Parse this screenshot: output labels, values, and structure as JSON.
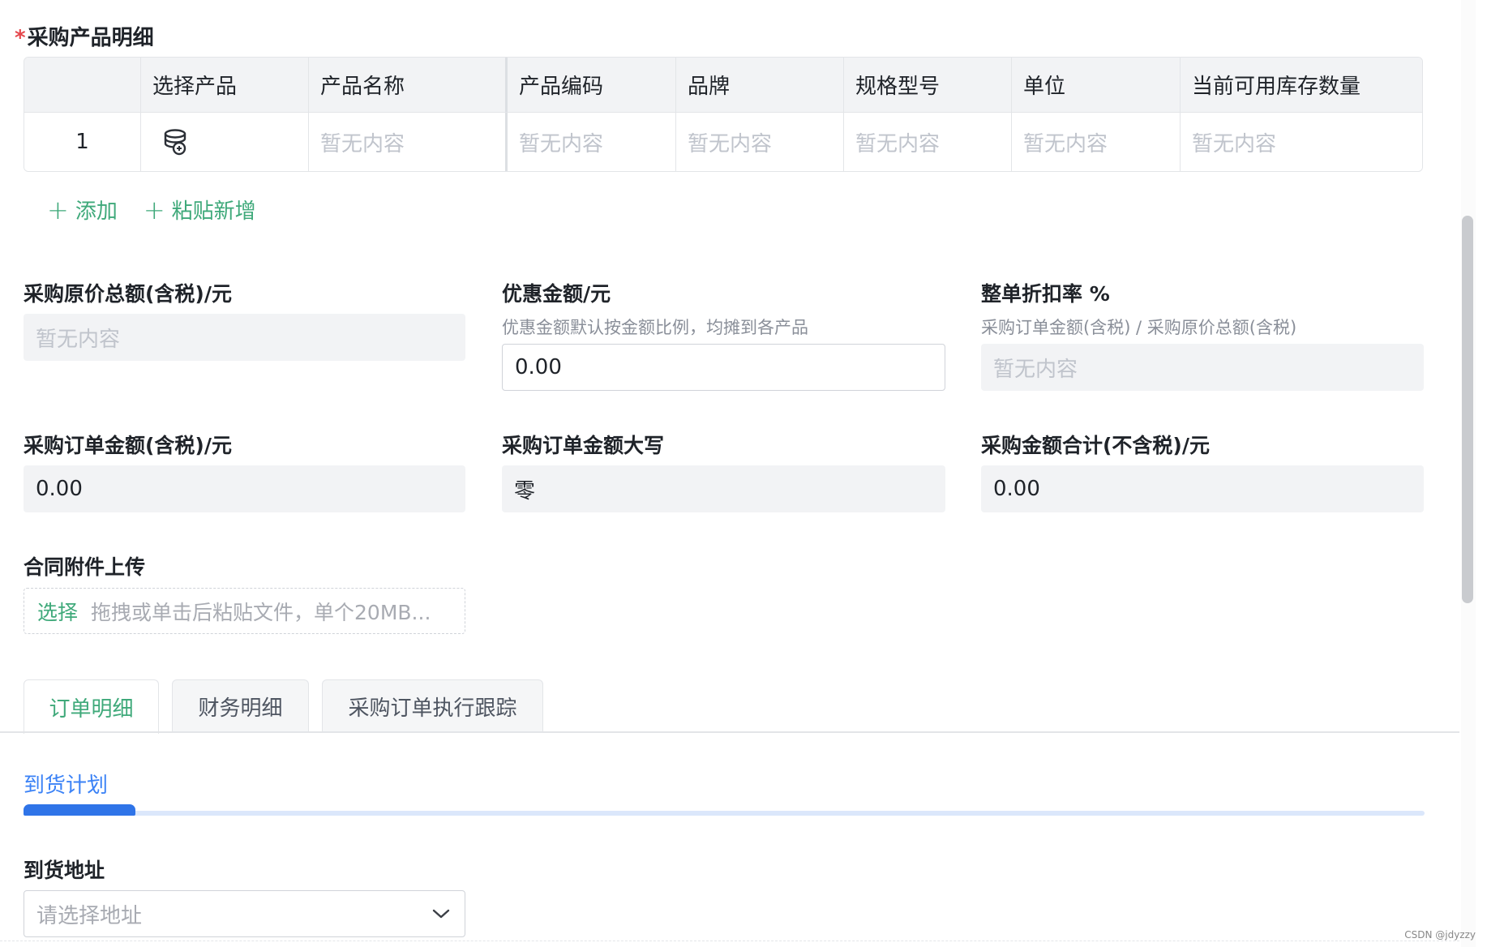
{
  "section": {
    "required_mark": "*",
    "title": "采购产品明细"
  },
  "product_table": {
    "headers": [
      "",
      "选择产品",
      "产品名称",
      "产品编码",
      "品牌",
      "规格型号",
      "单位",
      "当前可用库存数量"
    ],
    "row": {
      "index": "1",
      "placeholder": "暂无内容"
    }
  },
  "actions": {
    "add": "添加",
    "paste_add": "粘贴新增"
  },
  "form": {
    "original_total": {
      "label": "采购原价总额(含税)/元",
      "value": "暂无内容"
    },
    "discount_amount": {
      "label": "优惠金额/元",
      "hint": "优惠金额默认按金额比例，均摊到各产品",
      "value": "0.00"
    },
    "discount_rate": {
      "label": "整单折扣率 %",
      "hint": "采购订单金额(含税) / 采购原价总额(含税)",
      "value": "暂无内容"
    },
    "order_amount": {
      "label": "采购订单金额(含税)/元",
      "value": "0.00"
    },
    "order_amount_upper": {
      "label": "采购订单金额大写",
      "value": "零"
    },
    "total_excl_tax": {
      "label": "采购金额合计(不含税)/元",
      "value": "0.00"
    }
  },
  "upload": {
    "label": "合同附件上传",
    "pick": "选择",
    "tip": "拖拽或单击后粘贴文件，单个20MB..."
  },
  "tabs": [
    "订单明细",
    "财务明细",
    "采购订单执行跟踪"
  ],
  "subtab": {
    "label": "到货计划",
    "progress": 0.08
  },
  "address": {
    "label": "到货地址",
    "placeholder": "请选择地址"
  },
  "watermark": "CSDN @jdyzzy",
  "colors": {
    "accent_green": "#3fa97a",
    "accent_blue": "#2f74e8",
    "required_red": "#e5484d"
  }
}
